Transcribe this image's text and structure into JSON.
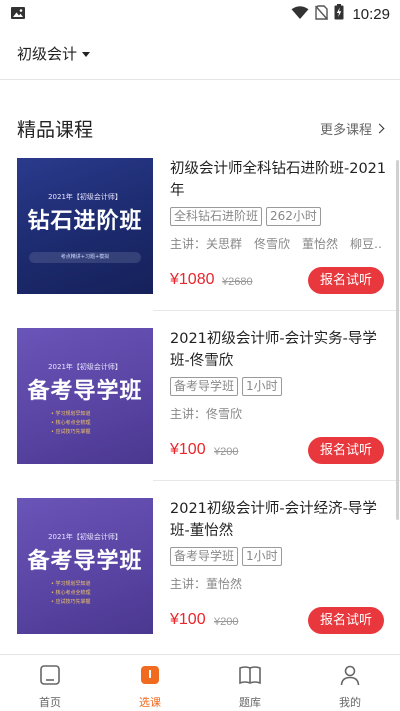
{
  "status_bar": {
    "time": "10:29",
    "icons": [
      "image-icon",
      "wifi-icon",
      "no-sim-icon",
      "battery-charging-icon"
    ]
  },
  "top_bar": {
    "subject": "初级会计"
  },
  "section": {
    "title": "精品课程",
    "more": "更多课程"
  },
  "courses": [
    {
      "title": "初级会计师全科钻石进阶班-2021年",
      "tags": [
        "全科钻石进阶班",
        "262小时"
      ],
      "teachers": "主讲：关思群　佟雪欣　董怡然　柳豆…",
      "price": "¥1080",
      "old_price": "¥2680",
      "button": "报名试听",
      "thumb": {
        "year": "2021年【初级会计师】",
        "headline": "钻石进阶班",
        "sub": "考点精讲+习题+模拟"
      }
    },
    {
      "title": "2021初级会计师-会计实务-导学班-佟雪欣",
      "tags": [
        "备考导学班",
        "1小时"
      ],
      "teachers": "主讲：佟雪欣",
      "price": "¥100",
      "old_price": "¥200",
      "button": "报名试听",
      "thumb": {
        "year": "2021年【初级会计师】",
        "headline": "备考导学班",
        "bullets": [
          "• 学习规划早知道",
          "• 核心考点全梳理",
          "• 应试技巧先掌握"
        ]
      }
    },
    {
      "title": "2021初级会计师-会计经济-导学班-董怡然",
      "tags": [
        "备考导学班",
        "1小时"
      ],
      "teachers": "主讲：董怡然",
      "price": "¥100",
      "old_price": "¥200",
      "button": "报名试听",
      "thumb": {
        "year": "2021年【初级会计师】",
        "headline": "备考导学班",
        "bullets": [
          "• 学习规划早知道",
          "• 核心考点全梳理",
          "• 应试技巧先掌握"
        ]
      }
    }
  ],
  "bottom_nav": [
    {
      "label": "首页",
      "icon": "home-icon"
    },
    {
      "label": "选课",
      "icon": "course-icon"
    },
    {
      "label": "题库",
      "icon": "book-icon"
    },
    {
      "label": "我的",
      "icon": "person-icon"
    }
  ],
  "colors": {
    "accent_red": "#e8383d",
    "price_red": "#e8262c",
    "nav_active": "#f06a1f"
  }
}
